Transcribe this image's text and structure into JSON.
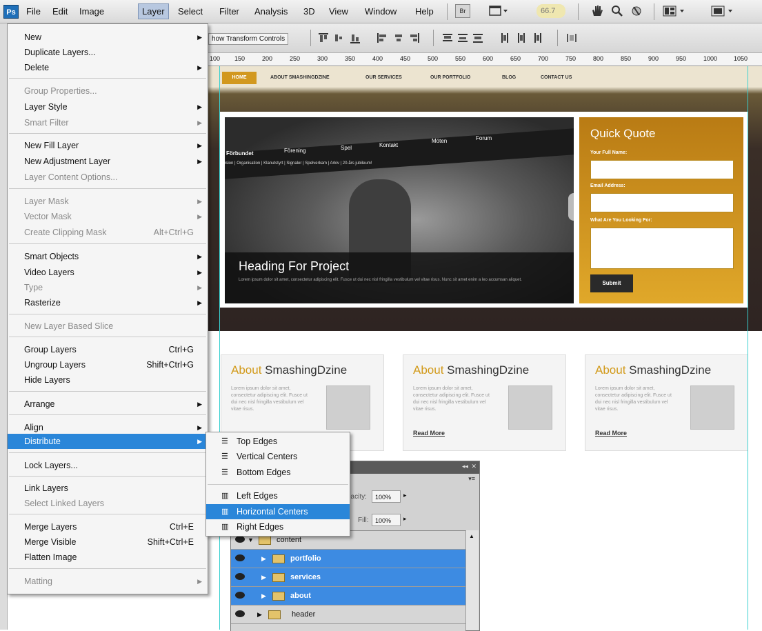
{
  "menubar": {
    "logo": "Ps",
    "items": [
      "File",
      "Edit",
      "Image",
      "Layer",
      "Select",
      "Filter",
      "Analysis",
      "3D",
      "View",
      "Window",
      "Help"
    ],
    "zoom": "66.7",
    "icons": [
      "bridge-icon",
      "screen-mode-icon",
      "hand-tool-icon",
      "zoom-tool-icon",
      "rotate-view-icon",
      "arrange-documents-icon",
      "screen-layout-icon"
    ]
  },
  "options_bar": {
    "show_transform": "how Transform Controls"
  },
  "ruler": {
    "ticks": [
      "100",
      "150",
      "200",
      "250",
      "300",
      "350",
      "400",
      "450",
      "500",
      "550",
      "600",
      "650",
      "700",
      "750",
      "800",
      "850",
      "900",
      "950",
      "1000",
      "1050"
    ]
  },
  "layer_menu": {
    "new": "New",
    "duplicate": "Duplicate Layers...",
    "delete": "Delete",
    "group_properties": "Group Properties...",
    "layer_style": "Layer Style",
    "smart_filter": "Smart Filter",
    "new_fill_layer": "New Fill Layer",
    "new_adjustment_layer": "New Adjustment Layer",
    "layer_content_options": "Layer Content Options...",
    "layer_mask": "Layer Mask",
    "vector_mask": "Vector Mask",
    "create_clipping_mask": "Create Clipping Mask",
    "create_clipping_mask_shortcut": "Alt+Ctrl+G",
    "smart_objects": "Smart Objects",
    "video_layers": "Video Layers",
    "type": "Type",
    "rasterize": "Rasterize",
    "new_layer_based_slice": "New Layer Based Slice",
    "group_layers": "Group Layers",
    "group_layers_shortcut": "Ctrl+G",
    "ungroup_layers": "Ungroup Layers",
    "ungroup_layers_shortcut": "Shift+Ctrl+G",
    "hide_layers": "Hide Layers",
    "arrange": "Arrange",
    "align": "Align",
    "distribute": "Distribute",
    "lock_layers": "Lock Layers...",
    "link_layers": "Link Layers",
    "select_linked_layers": "Select Linked Layers",
    "merge_layers": "Merge Layers",
    "merge_layers_shortcut": "Ctrl+E",
    "merge_visible": "Merge Visible",
    "merge_visible_shortcut": "Shift+Ctrl+E",
    "flatten_image": "Flatten Image",
    "matting": "Matting"
  },
  "distribute_submenu": {
    "top_edges": "Top Edges",
    "vertical_centers": "Vertical Centers",
    "bottom_edges": "Bottom Edges",
    "left_edges": "Left Edges",
    "horizontal_centers": "Horizontal Centers",
    "right_edges": "Right Edges"
  },
  "layers_panel": {
    "opacity_label": "pacity:",
    "opacity_value": "100%",
    "fill_label": "Fill:",
    "fill_value": "100%",
    "layers": [
      {
        "name": "content",
        "selected": false
      },
      {
        "name": "portfolio",
        "selected": true
      },
      {
        "name": "services",
        "selected": true
      },
      {
        "name": "about",
        "selected": true
      },
      {
        "name": "header",
        "selected": false
      }
    ]
  },
  "canvas": {
    "nav": [
      "HOME",
      "ABOUT SMASHINGDZINE",
      "OUR SERVICES",
      "OUR PORTFOLIO",
      "BLOG",
      "CONTACT US"
    ],
    "slider_nav": [
      "Förbundet",
      "Förening",
      "Spel",
      "Kontakt",
      "Möten",
      "Forum"
    ],
    "slider_subnav": "ision | Organisation | Klanutstyrt | Signaler | Spelverkam | Arkiv | 20-års jubileum!",
    "slider_heading": "Heading For Project",
    "slider_text": "Lorem ipsum dolor sit amet, consectetur adipiscing elit. Fusce ut dui nec nisl fringilla vestibulum vel vitae risus. Nunc sit amet enim a leo accumsan aliquet.",
    "quote_title": "Quick Quote",
    "quote_name_label": "Your Full Name:",
    "quote_email_label": "Email Address:",
    "quote_looking_label": "What Are You Looking For:",
    "quote_submit": "Submit",
    "about_title_accent": "About",
    "about_title_rest": " SmashingDzine",
    "about_text": "Lorem ipsum dolor sit amet, consectetur adipiscing elit. Fusce ut dui nec nisl fringilla vestibulum vel vitae risus.",
    "read_more": "Read More"
  },
  "colors": {
    "menu_highlight": "#2a86d9",
    "layer_selected": "#3d8be2",
    "quote_orange": "#d2981e",
    "header_dark": "#2e2422"
  }
}
